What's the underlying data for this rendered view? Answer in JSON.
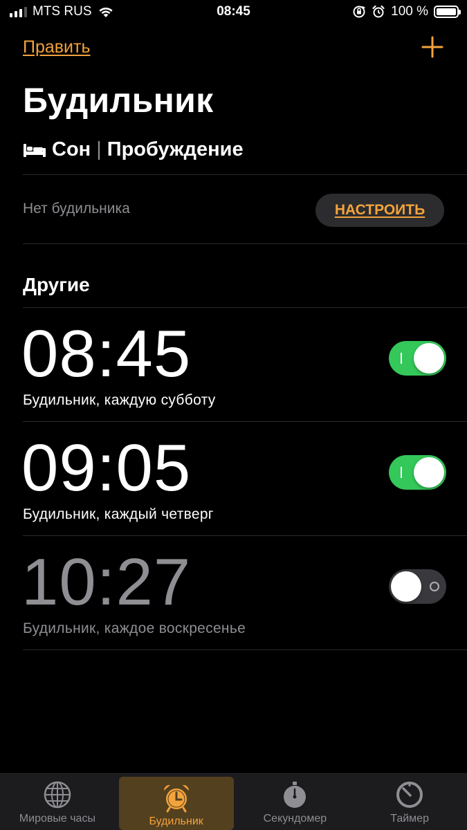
{
  "status_bar": {
    "carrier": "MTS RUS",
    "time": "08:45",
    "battery": "100 %"
  },
  "header": {
    "edit_label": "Править",
    "title": "Будильник"
  },
  "sleep": {
    "sleep_label": "Сон",
    "separator": "|",
    "wake_label": "Пробуждение",
    "no_alarm": "Нет будильника",
    "setup_label": "НАСТРОИТЬ"
  },
  "others": {
    "section_title": "Другие",
    "alarms": [
      {
        "time": "08:45",
        "label": "Будильник, каждую субботу",
        "enabled": true
      },
      {
        "time": "09:05",
        "label": "Будильник, каждый четверг",
        "enabled": true
      },
      {
        "time": "10:27",
        "label": "Будильник, каждое воскресенье",
        "enabled": false
      }
    ]
  },
  "tabs": [
    {
      "label": "Мировые часы",
      "icon": "globe-icon",
      "active": false
    },
    {
      "label": "Будильник",
      "icon": "alarm-clock-icon",
      "active": true
    },
    {
      "label": "Секундомер",
      "icon": "stopwatch-icon",
      "active": false
    },
    {
      "label": "Таймер",
      "icon": "timer-icon",
      "active": false
    }
  ],
  "colors": {
    "accent": "#f3a33c",
    "toggle_on": "#34c759",
    "background": "#000000",
    "secondary_text": "#8e8e93"
  }
}
